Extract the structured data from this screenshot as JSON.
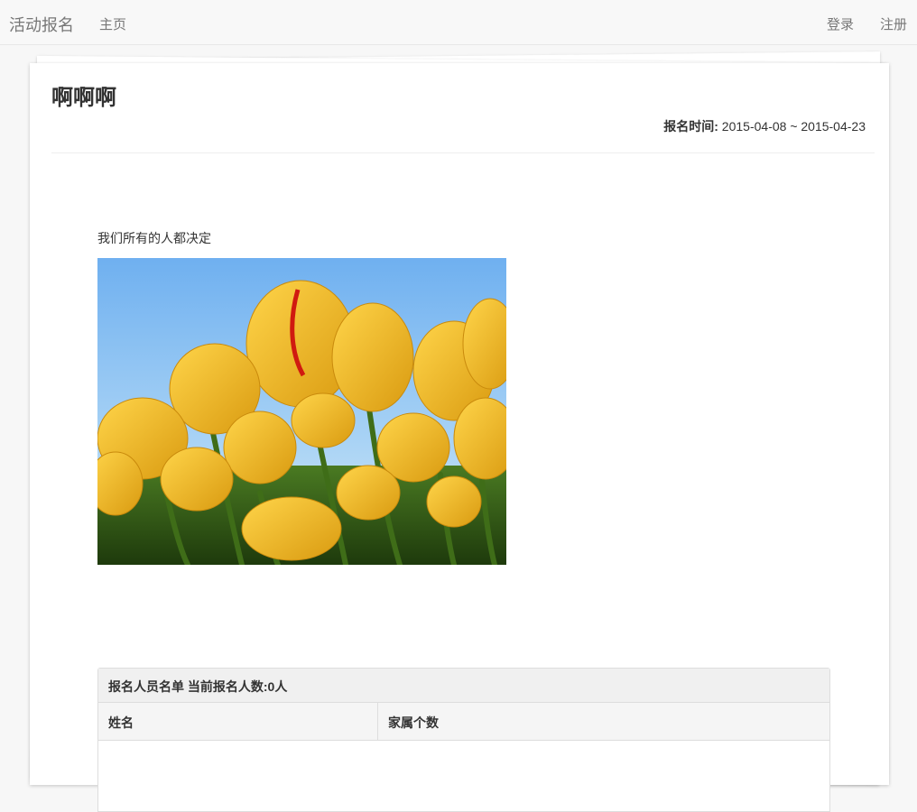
{
  "navbar": {
    "brand": "活动报名",
    "home": "主页",
    "login": "登录",
    "register": "注册"
  },
  "event": {
    "title": "啊啊啊",
    "time_label": "报名时间:",
    "time_value": " 2015-04-08 ~ 2015-04-23",
    "description": "我们所有的人都决定"
  },
  "signup": {
    "heading": "报名人员名单 当前报名人数:0人",
    "columns": [
      "姓名",
      "家属个数"
    ]
  },
  "colors": {
    "sky": "#7db8ee",
    "tulip": "#f2b51c",
    "stem": "#4c7a1f"
  }
}
